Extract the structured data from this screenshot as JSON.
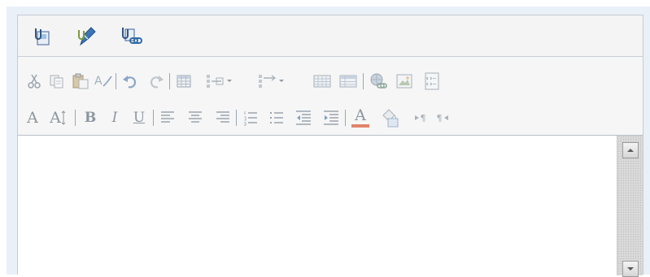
{
  "editor": {
    "top_toolbar": {
      "icons": [
        "insert-attachment-icon",
        "edit-hyperlink-icon",
        "attach-link-icon"
      ]
    },
    "format_toolbar": {
      "row1_icons": [
        "cut-icon",
        "copy-icon",
        "paste-icon",
        "spelling-icon",
        "undo-icon",
        "redo-icon",
        "insert-table-icon",
        "insert-row-dropdown-icon",
        "insert-column-dropdown-icon",
        "table-grid-icon",
        "table-properties-icon",
        "insert-web-link-icon",
        "insert-image-icon",
        "source-view-icon"
      ],
      "text_labels": {
        "font_size_small": "A",
        "font_size_large": "A",
        "bold": "B",
        "italic": "I",
        "underline": "U",
        "font_color": "A",
        "ltr_marker": "¶",
        "rtl_marker": "¶"
      },
      "row2_icons": [
        "align-left-icon",
        "align-center-icon",
        "align-right-icon",
        "numbered-list-icon",
        "bulleted-list-icon",
        "decrease-indent-icon",
        "increase-indent-icon",
        "font-color-icon",
        "highlight-color-icon",
        "left-to-right-icon",
        "right-to-left-icon"
      ],
      "font_color_bar": "#e2836a"
    },
    "scrollbar": {
      "up_icon": "scroll-up-arrow-icon",
      "down_icon": "scroll-down-arrow-icon"
    },
    "body_text": ""
  }
}
